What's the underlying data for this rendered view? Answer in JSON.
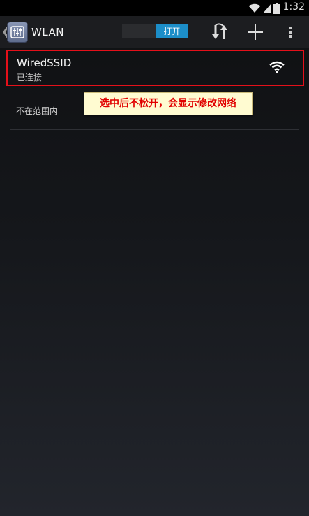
{
  "status_bar": {
    "time": "1:32",
    "icons": [
      "wifi-signal-icon",
      "cell-signal-icon",
      "battery-icon"
    ]
  },
  "action_bar": {
    "up_icon": "chevron-left-icon",
    "app_icon": "settings-app-icon",
    "title": "WLAN",
    "toggle_on_label": "打开",
    "actions": [
      "wps-refresh-icon",
      "add-icon",
      "overflow-menu-icon"
    ]
  },
  "networks": [
    {
      "ssid": "WiredSSID",
      "status": "已连接",
      "signal_icon": "wifi-signal-icon"
    }
  ],
  "out_of_range_label": "不在范围内",
  "tooltip": "选中后不松开，会显示修改网络",
  "colors": {
    "highlight_border": "#e4101a",
    "toggle_on": "#1c8ec9",
    "tooltip_bg": "#fffbd1",
    "tooltip_text": "#e10000"
  }
}
